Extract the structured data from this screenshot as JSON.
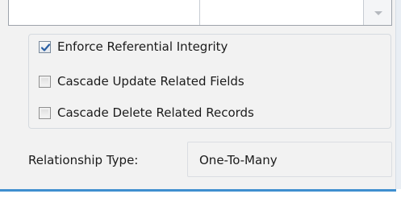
{
  "options": {
    "enforce": {
      "label": "Enforce Referential Integrity",
      "checked": true
    },
    "cascade_update": {
      "label": "Cascade Update Related Fields",
      "checked": false
    },
    "cascade_delete": {
      "label": "Cascade Delete Related Records",
      "checked": false
    }
  },
  "relationship": {
    "label": "Relationship Type:",
    "value": "One-To-Many"
  },
  "colors": {
    "accent_line": "#3f8fcf",
    "check_mark": "#2a5fa3"
  },
  "icons": {
    "checkbox_checked": "checkmark-icon",
    "grid_scroll": "chevron-down-icon"
  }
}
